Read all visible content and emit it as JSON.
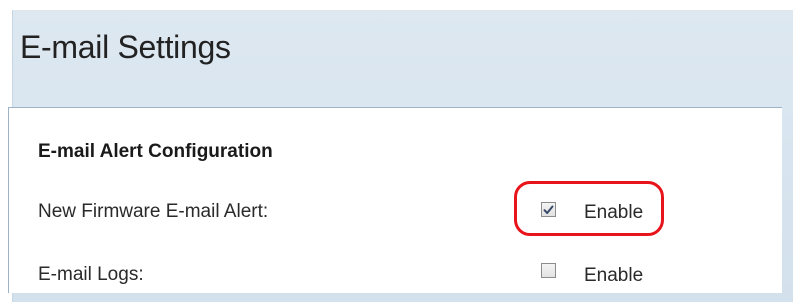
{
  "page": {
    "title": "E-mail Settings"
  },
  "section": {
    "title": "E-mail Alert Configuration",
    "rows": [
      {
        "label": "New Firmware E-mail Alert:",
        "checkbox_label": "Enable",
        "checked": true
      },
      {
        "label": "E-mail Logs:",
        "checkbox_label": "Enable",
        "checked": false
      }
    ]
  },
  "colors": {
    "header_background": "#d6e3ee",
    "highlight_outline": "#e8141b",
    "panel_background": "#ffffff"
  },
  "icons": {
    "checked_mark": "checkmark-icon"
  }
}
